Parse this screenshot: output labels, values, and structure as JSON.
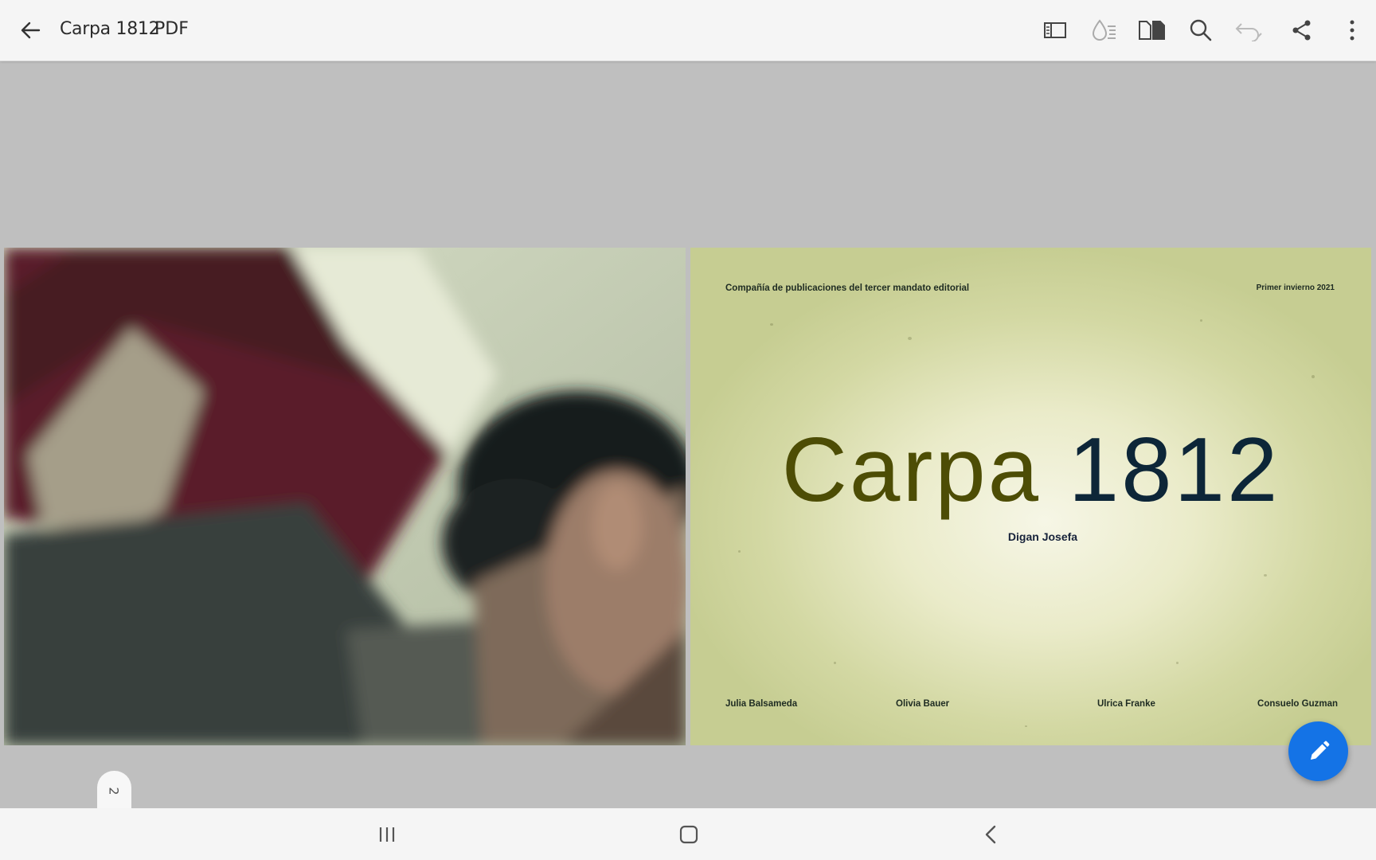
{
  "app": {
    "title": "Carpa 1812",
    "file_type": "PDF"
  },
  "toolbar": {
    "icons": [
      "back-arrow-icon",
      "panel-view-icon",
      "color-drop-icon",
      "page-layout-icon",
      "search-icon",
      "undo-icon",
      "share-icon",
      "more-vert-icon"
    ],
    "accent_color": "#1473e6"
  },
  "document": {
    "left_page": {
      "image": "blurred-photo-of-person"
    },
    "cover": {
      "header": "Compañía de publicaciones del tercer mandato editorial",
      "date": "Primer invierno 2021",
      "title_word": "Carpa",
      "title_number": "1812",
      "author": "Digan Josefa",
      "names": [
        "Julia Balsameda",
        "Olivia Bauer",
        "Ulrica Franke",
        "Consuelo Guzman"
      ]
    }
  },
  "page_indicator": "2",
  "navbar": {
    "icons": [
      "recent-apps-icon",
      "home-icon",
      "nav-back-icon"
    ]
  }
}
